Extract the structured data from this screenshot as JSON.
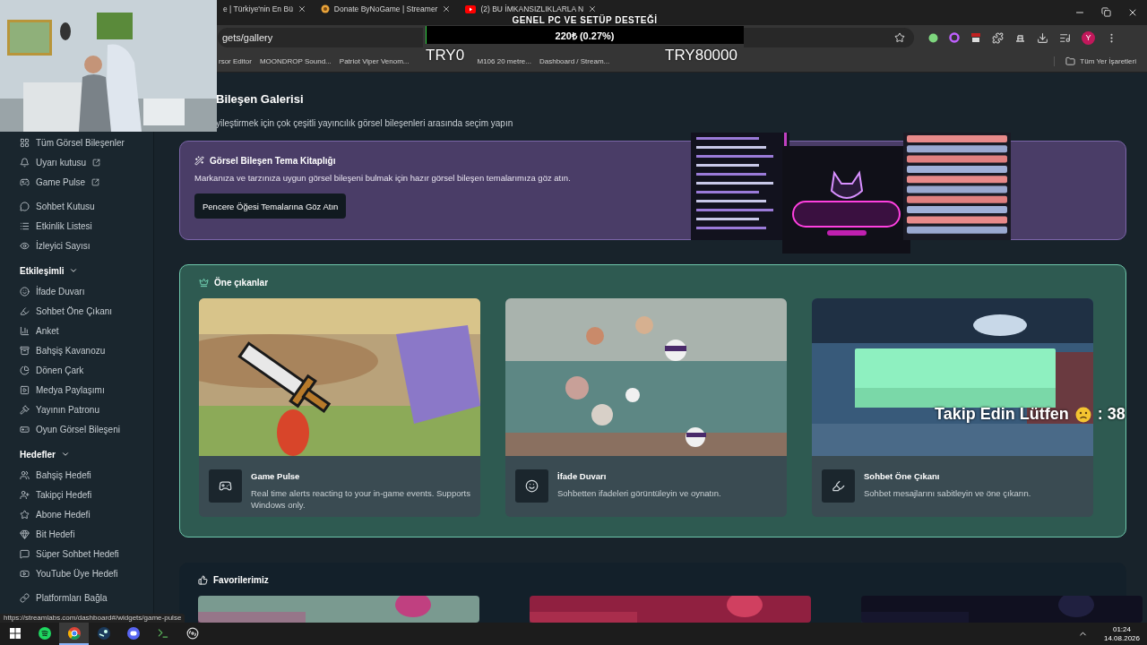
{
  "browser": {
    "tabs": [
      {
        "title": "e | Türkiye'nin En Bü",
        "selected": false
      },
      {
        "title": "Donate ByNoGame | Streamer",
        "selected": false
      },
      {
        "title": "(2) BU İMKANSIZLIKLARLA N",
        "selected": false
      }
    ],
    "address": "gets/gallery",
    "profile_initial": "Y",
    "bookmarks": [
      "rsor Editor",
      "MOONDROP Sound...",
      "Patriot Viper Venom...",
      "M106 20 metre...",
      "Dashboard / Stream..."
    ],
    "all_bookmarks": "Tüm Yer İşaretleri"
  },
  "stream_overlay": {
    "goal_title": "GENEL PC VE SETÜP DESTEĞİ",
    "progress": "220₺ (0.27%)",
    "level": 0.0027,
    "min": "TRY0",
    "max": "TRY80000",
    "follow_text": "Takip Edin Lütfen",
    "follow_count": ": 38"
  },
  "sidebar": {
    "groups": [
      {
        "items": [
          {
            "label": "Tüm Görsel Bileşenler",
            "external": false
          },
          {
            "label": "Uyarı kutusu",
            "external": true
          },
          {
            "label": "Game Pulse",
            "external": true
          }
        ]
      },
      {
        "items": [
          {
            "label": "Sohbet Kutusu",
            "external": false
          },
          {
            "label": "Etkinlik Listesi",
            "external": false
          },
          {
            "label": "İzleyici Sayısı",
            "external": false
          }
        ]
      },
      {
        "title": "Etkileşimli",
        "items": [
          {
            "label": "İfade Duvarı",
            "external": false
          },
          {
            "label": "Sohbet Öne Çıkanı",
            "external": false
          },
          {
            "label": "Anket",
            "external": false
          },
          {
            "label": "Bahşiş Kavanozu",
            "external": false
          },
          {
            "label": "Dönen Çark",
            "external": false
          },
          {
            "label": "Medya Paylaşımı",
            "external": false
          },
          {
            "label": "Yayının Patronu",
            "external": false
          },
          {
            "label": "Oyun Görsel Bileşeni",
            "external": false
          }
        ]
      },
      {
        "title": "Hedefler",
        "items": [
          {
            "label": "Bahşiş Hedefi",
            "external": false
          },
          {
            "label": "Takipçi Hedefi",
            "external": false
          },
          {
            "label": "Abone Hedefi",
            "external": false
          },
          {
            "label": "Bit Hedefi",
            "external": false
          },
          {
            "label": "Süper Sohbet Hedefi",
            "external": false
          },
          {
            "label": "YouTube Üye Hedefi",
            "external": false
          }
        ]
      }
    ],
    "footer": "Platformları Bağla"
  },
  "page": {
    "title": "Bileşen Galerisi",
    "subtitle": "yileştirmek için çok çeşitli yayıncılık görsel bileşenleri arasında seçim yapın"
  },
  "theme_banner": {
    "title": "Görsel Bileşen Tema Kitaplığı",
    "description": "Markanıza ve tarzınıza uygun görsel bileşeni bulmak için hazır görsel bileşen temalarımıza göz atın.",
    "button": "Pencere Öğesi Temalarına Göz Atın"
  },
  "featured": {
    "title": "Öne çıkanlar",
    "cards": [
      {
        "title": "Game Pulse",
        "description": "Real time alerts reacting to your in-game events. Supports Windows only."
      },
      {
        "title": "İfade Duvarı",
        "description": "Sohbetten ifadeleri görüntüleyin ve oynatın."
      },
      {
        "title": "Sohbet Öne Çıkanı",
        "description": "Sohbet mesajlarını sabitleyin ve öne çıkarın."
      }
    ]
  },
  "favorites": {
    "title": "Favorilerimiz"
  },
  "status_url": "https://streamlabs.com/dashboard#/widgets/game-pulse",
  "taskbar": {
    "apps": [
      {
        "selected": false
      },
      {
        "selected": true
      },
      {
        "selected": false
      },
      {
        "selected": false
      },
      {
        "selected": false
      },
      {
        "selected": false
      }
    ],
    "time": "01:24",
    "date": "14.08.2026"
  }
}
